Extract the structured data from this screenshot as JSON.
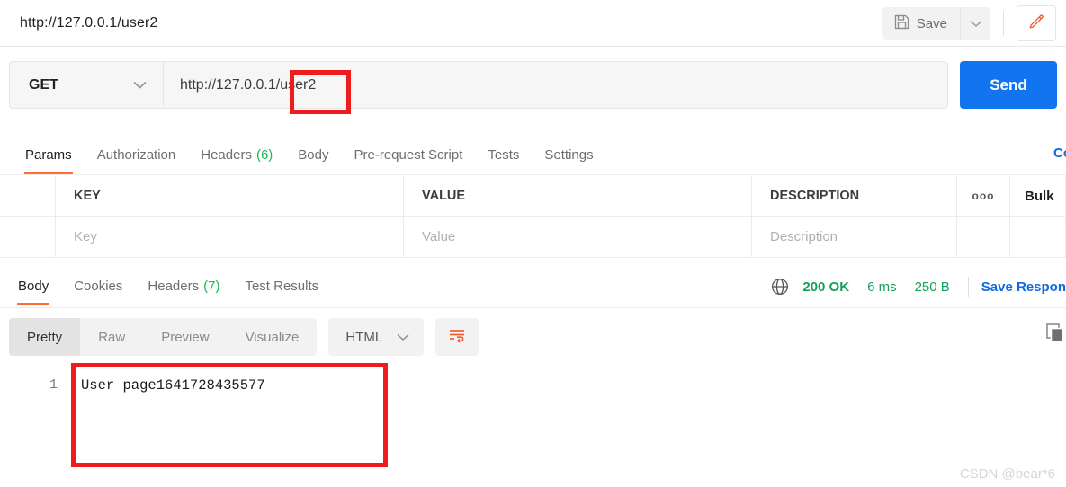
{
  "topbar": {
    "request_title": "http://127.0.0.1/user2",
    "save_label": "Save",
    "save_icon": "floppy-disk-icon",
    "save_caret_icon": "chevron-down-icon",
    "edit_icon": "pencil-icon"
  },
  "url_row": {
    "method": "GET",
    "method_caret_icon": "chevron-down-icon",
    "url": "http://127.0.0.1/user2",
    "send_label": "Send"
  },
  "request_tabs": {
    "items": [
      {
        "label": "Params",
        "count": "",
        "active": true
      },
      {
        "label": "Authorization",
        "count": "",
        "active": false
      },
      {
        "label": "Headers",
        "count": "(6)",
        "active": false
      },
      {
        "label": "Body",
        "count": "",
        "active": false
      },
      {
        "label": "Pre-request Script",
        "count": "",
        "active": false
      },
      {
        "label": "Tests",
        "count": "",
        "active": false
      },
      {
        "label": "Settings",
        "count": "",
        "active": false
      }
    ],
    "cookies_link": "Co"
  },
  "params_table": {
    "headers": {
      "key": "KEY",
      "value": "VALUE",
      "description": "DESCRIPTION",
      "menu_icon": "ooo",
      "bulk_edit": "Bulk"
    },
    "row": {
      "key_placeholder": "Key",
      "value_placeholder": "Value",
      "description_placeholder": "Description"
    }
  },
  "response_tabs": {
    "items": [
      {
        "label": "Body",
        "count": "",
        "active": true
      },
      {
        "label": "Cookies",
        "count": "",
        "active": false
      },
      {
        "label": "Headers",
        "count": "(7)",
        "active": false
      },
      {
        "label": "Test Results",
        "count": "",
        "active": false
      }
    ],
    "status": {
      "globe_icon": "globe-icon",
      "code": "200 OK",
      "time": "6 ms",
      "size": "250 B",
      "save_response": "Save Respon"
    }
  },
  "format_bar": {
    "segments": [
      {
        "label": "Pretty",
        "active": true
      },
      {
        "label": "Raw",
        "active": false
      },
      {
        "label": "Preview",
        "active": false
      },
      {
        "label": "Visualize",
        "active": false
      }
    ],
    "language": "HTML",
    "language_caret_icon": "chevron-down-icon",
    "wrap_icon": "word-wrap-icon",
    "copy_icon": "copy-icon"
  },
  "response_body": {
    "line_number": "1",
    "content": "User page1641728435577"
  },
  "watermark": "CSDN @bear*6",
  "colors": {
    "accent_orange": "#ff6c37",
    "send_blue": "#1274ef",
    "link_blue": "#0f6ae0",
    "status_green": "#14a05a",
    "annotation_red": "#ee1c1c"
  }
}
